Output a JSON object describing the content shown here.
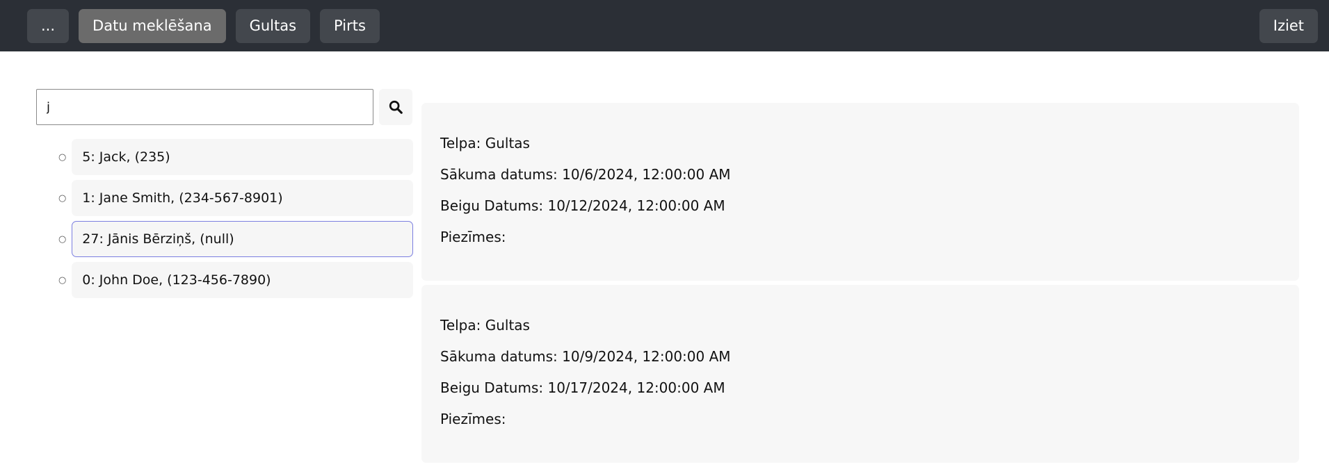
{
  "nav": {
    "items": [
      {
        "label": "...",
        "active": false
      },
      {
        "label": "Datu meklēšana",
        "active": true
      },
      {
        "label": "Gultas",
        "active": false
      },
      {
        "label": "Pirts",
        "active": false
      }
    ],
    "logout_label": "Iziet"
  },
  "search": {
    "value": "j",
    "icon": "search-icon"
  },
  "results": [
    {
      "label": "5: Jack, (235)",
      "selected": false
    },
    {
      "label": "1: Jane Smith, (234-567-8901)",
      "selected": false
    },
    {
      "label": "27: Jānis Bērziņš, (null)",
      "selected": true
    },
    {
      "label": "0: John Doe, (123-456-7890)",
      "selected": false
    }
  ],
  "bookings": [
    {
      "room": "Telpa: Gultas",
      "start": "Sākuma datums: 10/6/2024, 12:00:00 AM",
      "end": "Beigu Datums: 10/12/2024, 12:00:00 AM",
      "notes": "Piezīmes:"
    },
    {
      "room": "Telpa: Gultas",
      "start": "Sākuma datums: 10/9/2024, 12:00:00 AM",
      "end": "Beigu Datums: 10/17/2024, 12:00:00 AM",
      "notes": "Piezīmes:"
    }
  ],
  "colors": {
    "topbar": "#2b2f36",
    "nav_button": "#43474d",
    "nav_button_active": "#6b6b6b",
    "card_bg": "#f7f7f7",
    "selected_border": "#7b7ee0"
  }
}
